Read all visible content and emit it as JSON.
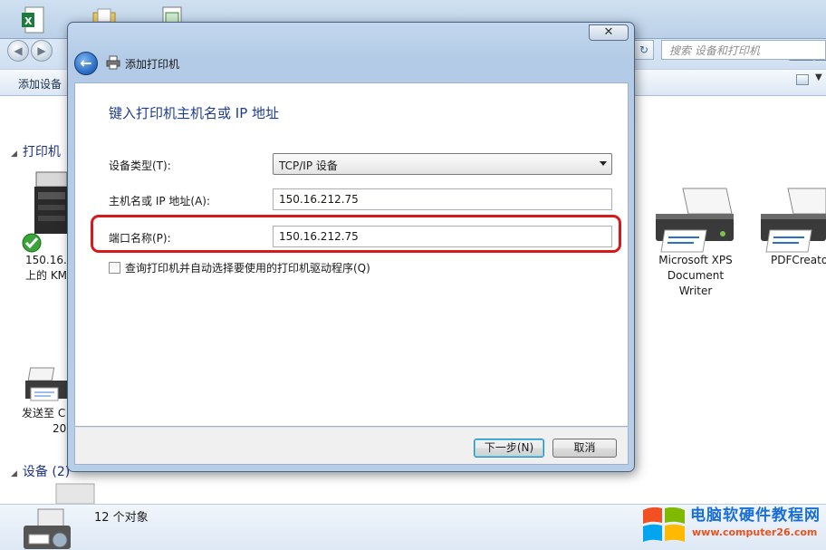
{
  "dialog": {
    "title": "添加打印机",
    "close_glyph": "✕",
    "back_glyph": "←",
    "heading": "键入打印机主机名或 IP 地址",
    "device_type_label": "设备类型(T):",
    "device_type_value": "TCP/IP 设备",
    "hostname_label": "主机名或 IP 地址(A):",
    "hostname_value": "150.16.212.75",
    "port_label": "端口名称(P):",
    "port_value": "150.16.212.75",
    "query_checkbox_label": "查询打印机并自动选择要使用的打印机驱动程序(Q)",
    "query_checked": false,
    "next_button": "下一步(N)",
    "cancel_button": "取消",
    "highlight_color": "#d7191c"
  },
  "explorer": {
    "search_placeholder": "搜索 设备和打印机",
    "add_device_cmd": "添加设备",
    "printers_group": "打印机",
    "devices_group": "设备 (2)",
    "printer_km_label_line1": "150.16.1",
    "printer_km_label_line2": "上的 KM",
    "send_to_label_line1": "发送至 C",
    "send_to_label_line2": "20",
    "xps_label": [
      "Microsoft XPS",
      "Document",
      "Writer"
    ],
    "pdfcreator_label": "PDFCreato",
    "status_text": "12 个对象"
  },
  "watermark": {
    "name": "电脑软硬件教程网",
    "url": "www.computer26.com"
  },
  "icons": {
    "back": "back-arrow-icon",
    "printer": "printer-icon",
    "check": "default-check-icon",
    "windows": "windows-logo-icon"
  },
  "colors": {
    "dialog_heading": "#1f3d8c",
    "group_heading": "#1e3287",
    "watermark_name": "#1a6fd6",
    "watermark_url": "#e8521e"
  }
}
